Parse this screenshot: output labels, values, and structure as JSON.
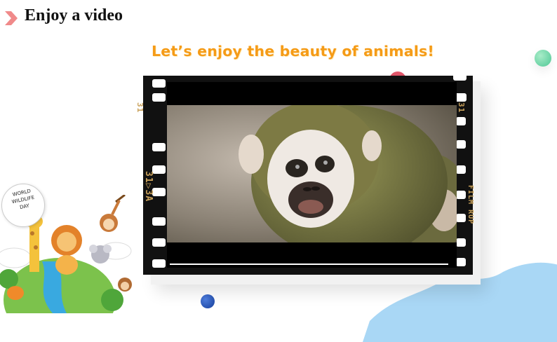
{
  "slide": {
    "title": "Enjoy a video",
    "subtitle": "Let’s enjoy the beauty of animals!"
  },
  "video": {
    "content": "squirrel-monkey-close-up",
    "progress": 0
  },
  "filmstrip": {
    "left_number": "31",
    "right_number": "31",
    "left_mark": "31▷3A",
    "right_brand": "FILM RUP"
  },
  "badge": {
    "line1": "WORLD",
    "line2": "WILDLIFE",
    "line3": "DAY"
  },
  "colors": {
    "accent": "#f59b17",
    "chevron": "#f08a8a",
    "film": "#111111",
    "green_dot": "#4fc795",
    "blue_dot": "#163e9a",
    "blob": "#a9d7f5"
  }
}
